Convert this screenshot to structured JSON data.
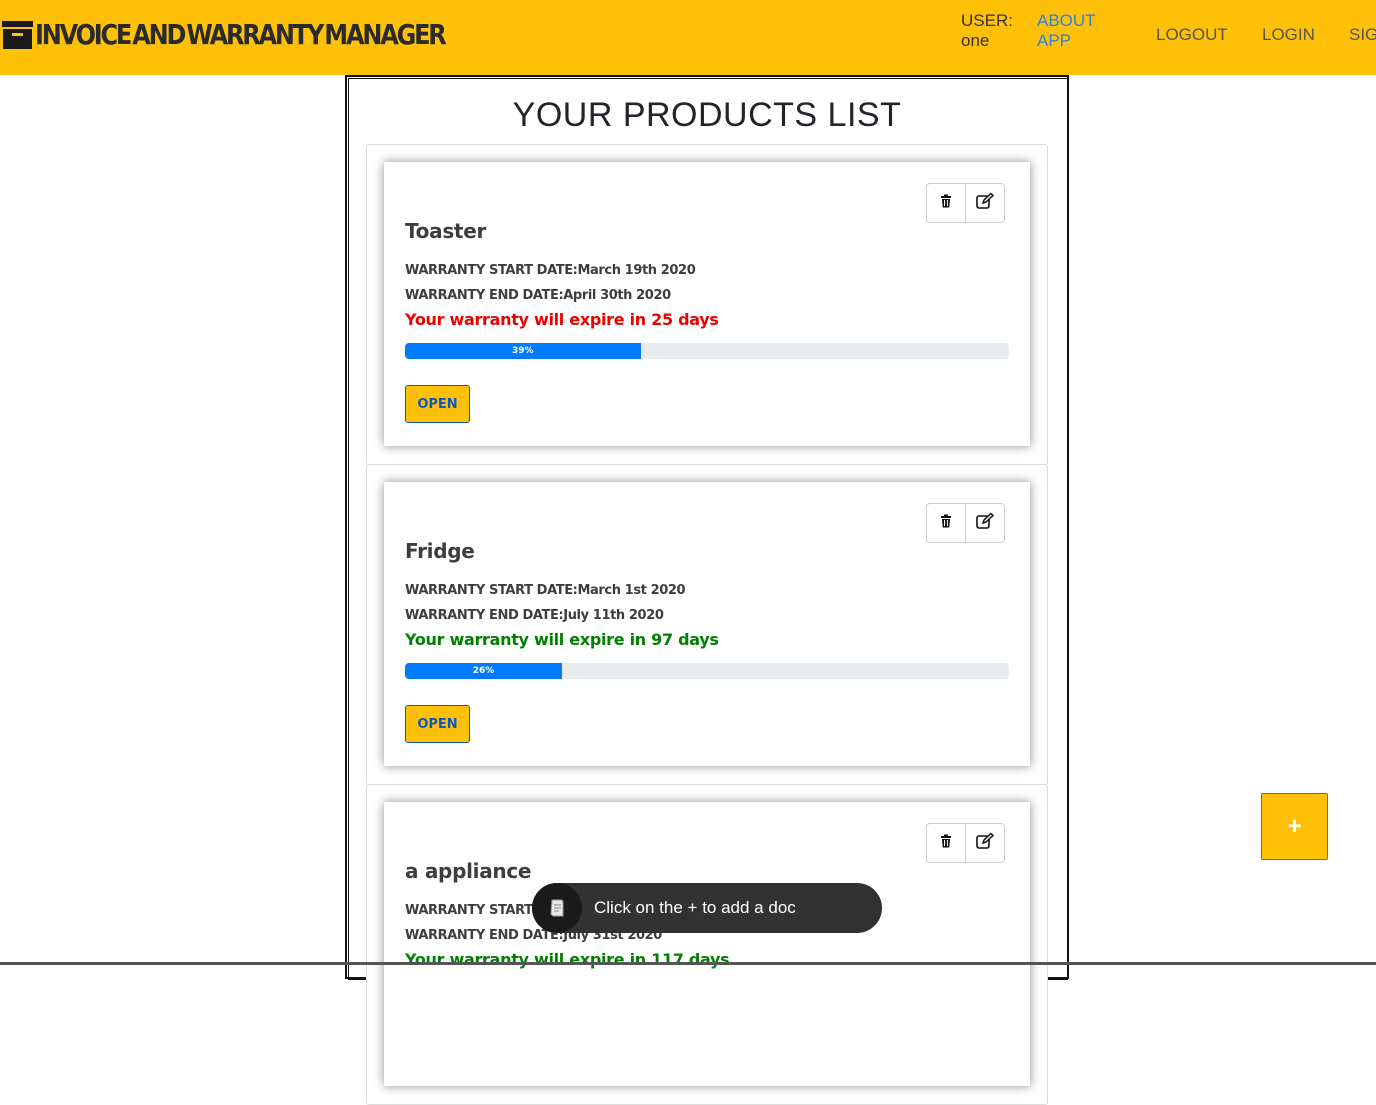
{
  "app": {
    "title": "INVOICE AND WARRANTY MANAGER",
    "brand_color": "#ffc107"
  },
  "nav": {
    "user_label": "USER:",
    "user_name": "one",
    "about_line1": "ABOUT",
    "about_line2": "APP",
    "logout": "LOGOUT",
    "login": "LOGIN",
    "signup": "SIG"
  },
  "main": {
    "title": "YOUR PRODUCTS LIST",
    "products": [
      {
        "name": "Toaster",
        "start": "WARRANTY START DATE:March 19th 2020",
        "end": "WARRANTY END DATE:April 30th 2020",
        "expire": "Your warranty will expire in 25 days",
        "expire_color": "#ee0000",
        "progress_label": "39%",
        "progress_value": 0.39,
        "open_label": "OPEN",
        "delete_icon": "trash-icon",
        "edit_icon": "edit-icon"
      },
      {
        "name": "Fridge",
        "start": "WARRANTY START DATE:March 1st 2020",
        "end": "WARRANTY END DATE:July 11th 2020",
        "expire": "Your warranty will expire in 97 days",
        "expire_color": "#008000",
        "progress_label": "26%",
        "progress_value": 0.26,
        "open_label": "OPEN",
        "delete_icon": "trash-icon",
        "edit_icon": "edit-icon"
      },
      {
        "name": "a appliance",
        "start": "WARRANTY START",
        "end": "WARRANTY END DATE:July 31st 2020",
        "expire": "Your warranty will expire in 117 days",
        "expire_color": "#008000",
        "delete_icon": "trash-icon",
        "edit_icon": "edit-icon"
      }
    ]
  },
  "fab": {
    "label": "+",
    "icon": "plus-icon"
  },
  "toast": {
    "text": "Click on the + to add a doc",
    "icon": "document-icon"
  }
}
